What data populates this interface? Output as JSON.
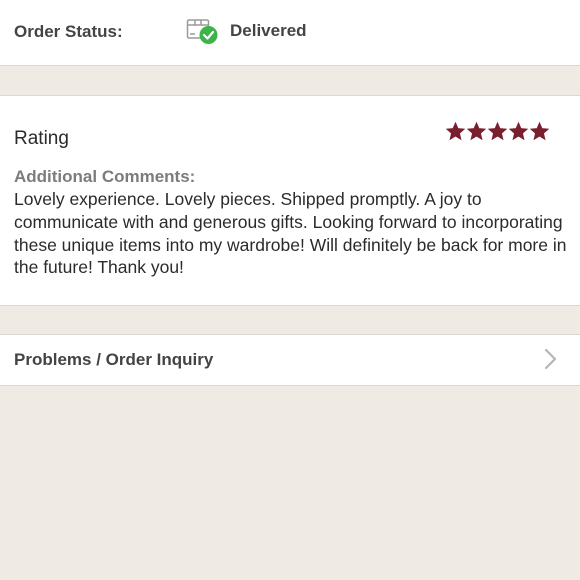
{
  "order_status": {
    "label": "Order Status:",
    "value": "Delivered",
    "icon": "package-delivered-icon",
    "check_color": "#3cb44a"
  },
  "rating": {
    "label": "Rating",
    "stars": 5,
    "max_stars": 5,
    "star_color": "#7a1f2e",
    "comments_label": "Additional Comments:",
    "comments_text": "Lovely experience. Lovely pieces. Shipped promptly. A joy to communicate with and generous gifts. Looking forward to incorporating these unique items into my wardrobe! Will definitely be back for more in the future! Thank you!"
  },
  "problems": {
    "label": "Problems / Order Inquiry",
    "icon": "chevron-right-icon"
  }
}
